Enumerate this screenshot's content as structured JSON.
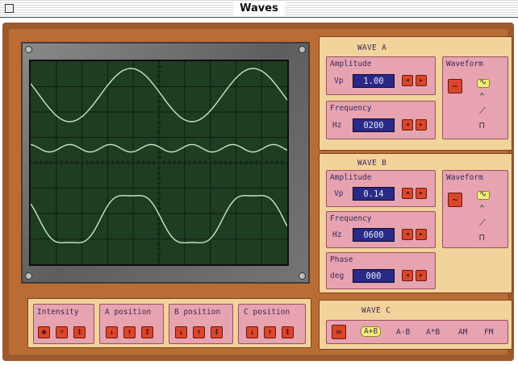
{
  "window": {
    "title": "Waves"
  },
  "wave_a": {
    "title": "WAVE A",
    "amplitude": {
      "label": "Amplitude",
      "unit": "Vp",
      "value": "1.00"
    },
    "frequency": {
      "label": "Frequency",
      "unit": "Hz",
      "value": "0200"
    },
    "waveform": {
      "label": "Waveform",
      "selected": "sine"
    }
  },
  "wave_b": {
    "title": "WAVE B",
    "amplitude": {
      "label": "Amplitude",
      "unit": "Vp",
      "value": "0.14"
    },
    "frequency": {
      "label": "Frequency",
      "unit": "Hz",
      "value": "0600"
    },
    "phase": {
      "label": "Phase",
      "unit": "deg",
      "value": "000"
    },
    "waveform": {
      "label": "Waveform",
      "selected": "sine"
    }
  },
  "wave_c": {
    "title": "WAVE C",
    "options": [
      "A+B",
      "A-B",
      "A*B",
      "AM",
      "FM"
    ],
    "selected": "A+B"
  },
  "controls": {
    "intensity": "Intensity",
    "a_position": "A position",
    "b_position": "B position",
    "c_position": "C position"
  },
  "colors": {
    "frame": "#b96c34",
    "panel": "#f2d39c",
    "sub_panel": "#e7a3b0",
    "field": "#2a2a86",
    "button": "#d9462c",
    "screen": "#1e3e22",
    "trace": "#c8e8c8"
  }
}
